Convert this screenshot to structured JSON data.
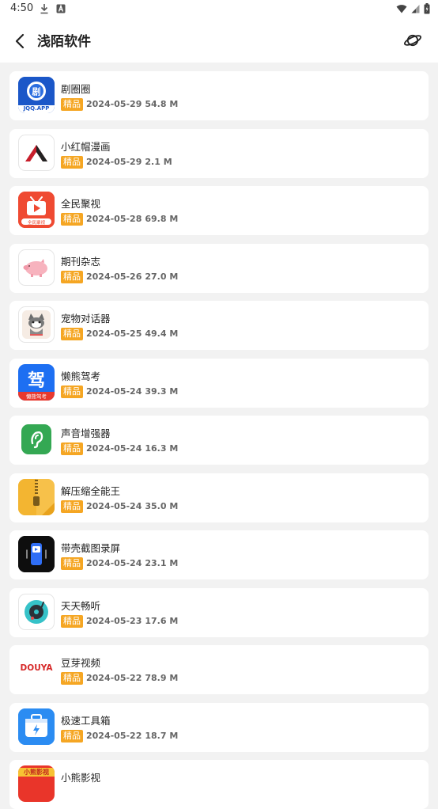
{
  "status_bar": {
    "time": "4:50"
  },
  "header": {
    "title": "浅陌软件"
  },
  "apps": [
    {
      "name": "剧圈圈",
      "badge": "精品",
      "date": "2024-05-29",
      "size": "54.8 M",
      "icon": "juquanquan-icon",
      "icon_text": "JQQ.APP"
    },
    {
      "name": "小红帽漫画",
      "badge": "精品",
      "date": "2024-05-29",
      "size": "2.1 M",
      "icon": "xiaohongmao-icon"
    },
    {
      "name": "全民聚视",
      "badge": "精品",
      "date": "2024-05-28",
      "size": "69.8 M",
      "icon": "quanmin-icon",
      "icon_text": "全民聚视"
    },
    {
      "name": "期刊杂志",
      "badge": "精品",
      "date": "2024-05-26",
      "size": "27.0 M",
      "icon": "pig-icon"
    },
    {
      "name": "宠物对话器",
      "badge": "精品",
      "date": "2024-05-25",
      "size": "49.4 M",
      "icon": "cat-icon"
    },
    {
      "name": "懒熊驾考",
      "badge": "精品",
      "date": "2024-05-24",
      "size": "39.3 M",
      "icon": "jiakao-icon",
      "icon_text": "驾",
      "icon_sub": "懒熊驾考"
    },
    {
      "name": "声音增强器",
      "badge": "精品",
      "date": "2024-05-24",
      "size": "16.3 M",
      "icon": "ear-icon"
    },
    {
      "name": "解压缩全能王",
      "badge": "精品",
      "date": "2024-05-24",
      "size": "35.0 M",
      "icon": "zip-icon"
    },
    {
      "name": "带壳截图录屏",
      "badge": "精品",
      "date": "2024-05-24",
      "size": "23.1 M",
      "icon": "phone-record-icon"
    },
    {
      "name": "天天畅听",
      "badge": "精品",
      "date": "2024-05-23",
      "size": "17.6 M",
      "icon": "record-player-icon"
    },
    {
      "name": "豆芽视频",
      "badge": "精品",
      "date": "2024-05-22",
      "size": "78.9 M",
      "icon": "douya-icon",
      "icon_text": "DOUYA"
    },
    {
      "name": "极速工具箱",
      "badge": "精品",
      "date": "2024-05-22",
      "size": "18.7 M",
      "icon": "toolbox-icon"
    },
    {
      "name": "小熊影视",
      "badge": "",
      "date": "",
      "size": "",
      "icon": "xiaoxiong-icon",
      "icon_text": "小熊影视"
    }
  ]
}
